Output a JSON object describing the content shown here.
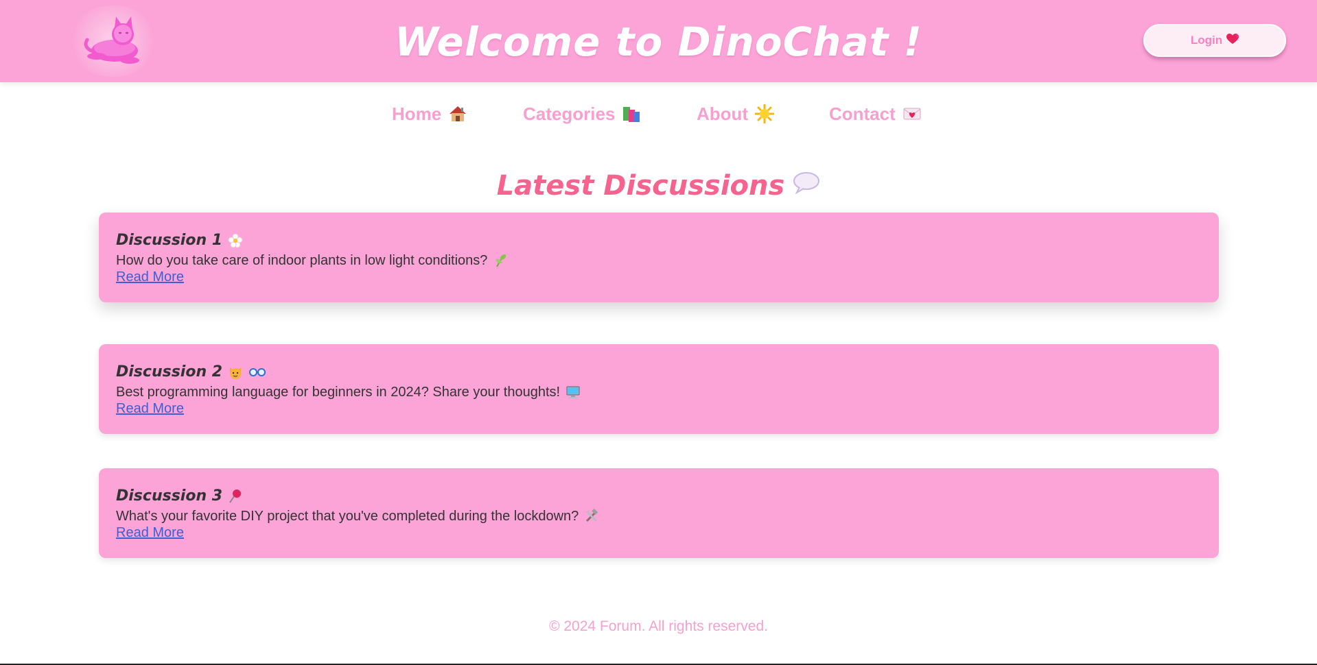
{
  "header": {
    "logo_icon": "pink-cat-icon",
    "title": "Welcome to DinoChat !",
    "login_label": "Login",
    "login_icon": "heart-icon"
  },
  "nav": {
    "items": [
      {
        "label": "Home",
        "icon": "house-icon"
      },
      {
        "label": "Categories",
        "icon": "books-icon"
      },
      {
        "label": "About",
        "icon": "sun-icon"
      },
      {
        "label": "Contact",
        "icon": "love-letter-icon"
      }
    ]
  },
  "main": {
    "heading": "Latest Discussions",
    "heading_icon": "speech-bubble-icon",
    "discussions": [
      {
        "title": "Discussion 1",
        "title_icons": [
          "flower-icon"
        ],
        "text": "How do you take care of indoor plants in low light conditions?",
        "text_icon": "seedling-icon",
        "link": "Read More"
      },
      {
        "title": "Discussion 2",
        "title_icons": [
          "cat-face-icon",
          "glasses-icon"
        ],
        "text": "Best programming language for beginners in 2024? Share your thoughts!",
        "text_icon": "computer-icon",
        "link": "Read More"
      },
      {
        "title": "Discussion 3",
        "title_icons": [
          "pushpin-icon"
        ],
        "text": "What's your favorite DIY project that you've completed during the lockdown?",
        "text_icon": "hammer-wrench-icon",
        "link": "Read More"
      }
    ]
  },
  "footer": {
    "text": "© 2024 Forum. All rights reserved."
  },
  "colors": {
    "header_bg": "#fca3d7",
    "card_bg": "#fca3d7",
    "nav_text": "#f7a0cf",
    "heading_text": "#f4648f",
    "link": "#3f5fd1",
    "body_text": "#333333"
  }
}
